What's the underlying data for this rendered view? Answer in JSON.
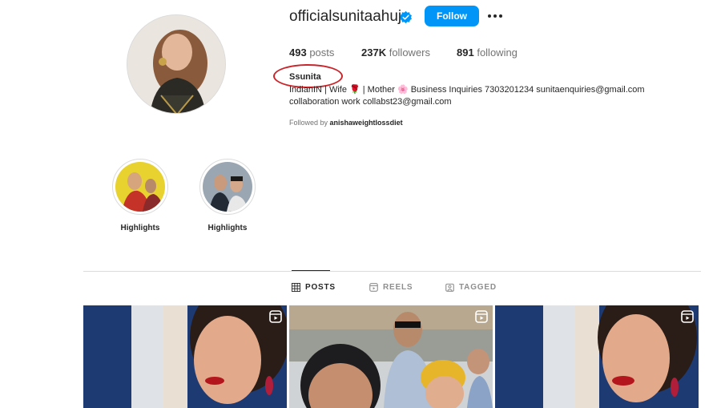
{
  "profile": {
    "username": "officialsunitaahuja",
    "follow_label": "Follow",
    "stats": {
      "posts_count": "493",
      "posts_label": "posts",
      "followers_count": "237K",
      "followers_label": "followers",
      "following_count": "891",
      "following_label": "following"
    },
    "full_name": "Ssunita",
    "bio_line1": "IndianIN | Wife 🌹 | Mother 🌸 Business Inquiries 7303201234 sunitaenquiries@gmail.com",
    "bio_line2": "collaboration work collabst23@gmail.com",
    "followed_by_prefix": "Followed by",
    "followed_by_user": "anishaweightlossdiet"
  },
  "highlights": [
    {
      "label": "Highlights"
    },
    {
      "label": "Highlights"
    }
  ],
  "tabs": [
    {
      "label": "POSTS",
      "icon": "grid-icon",
      "active": true
    },
    {
      "label": "REELS",
      "icon": "reels-icon",
      "active": false
    },
    {
      "label": "TAGGED",
      "icon": "tagged-icon",
      "active": false
    }
  ],
  "colors": {
    "follow_button": "#0095f6",
    "verified_badge": "#0095f6",
    "annotation_circle": "#c9262c"
  }
}
